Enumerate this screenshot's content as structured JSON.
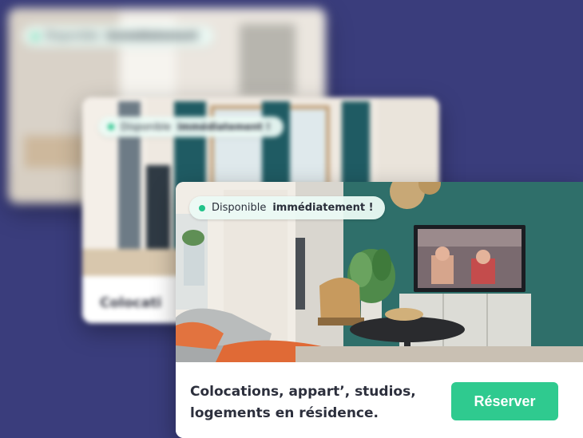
{
  "cards": {
    "back": {
      "badge_prefix": "Disponible",
      "badge_emphasis": "immédiatement"
    },
    "middle": {
      "badge_prefix": "Disponible",
      "badge_emphasis": "immédiatement !",
      "caption": "Colocati"
    },
    "front": {
      "badge_prefix": "Disponible",
      "badge_emphasis": "immédiatement !",
      "caption_line1": "Colocations, appart’, studios,",
      "caption_line2": "logements en résidence.",
      "button_label": "Réserver"
    }
  },
  "colors": {
    "background": "#3a3d7c",
    "accent": "#2fca8f",
    "badge_dot": "#22c38a",
    "wall_teal": "#2f6f6a"
  }
}
